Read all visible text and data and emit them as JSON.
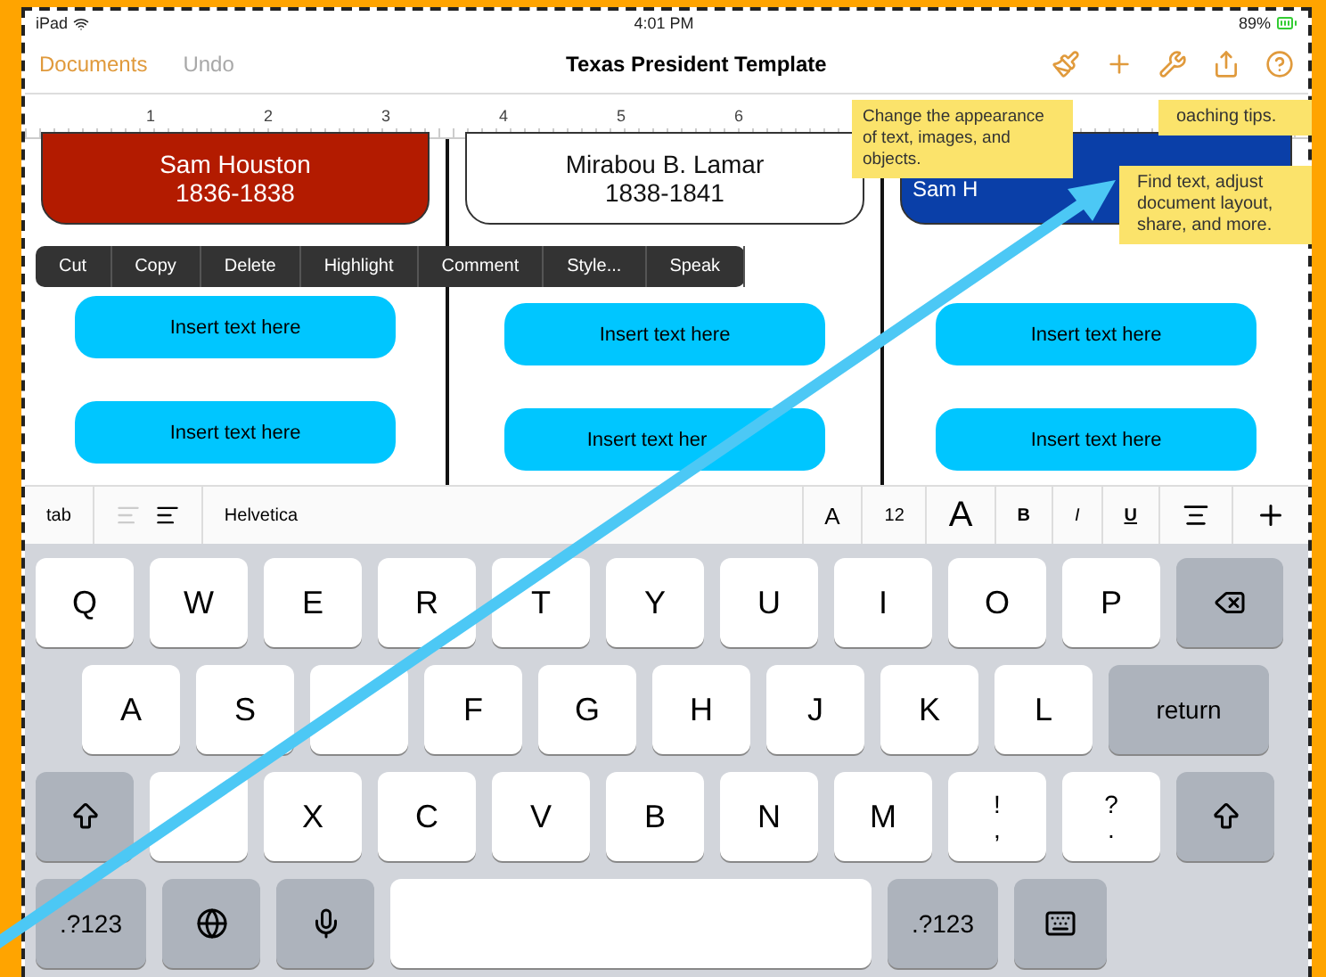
{
  "status_bar": {
    "device": "iPad",
    "time": "4:01 PM",
    "battery": "89%"
  },
  "nav": {
    "left": [
      {
        "label": "Documents",
        "disabled": false
      },
      {
        "label": "Undo",
        "disabled": true
      }
    ],
    "title": "Texas President Template"
  },
  "ruler": {
    "marks": [
      "1",
      "2",
      "3",
      "4",
      "5",
      "6"
    ]
  },
  "tooltips": [
    {
      "text": "Change the appearance of text, images, and objects."
    },
    {
      "text": "oaching tips."
    },
    {
      "text": "Find text, adjust document layout, share, and more."
    }
  ],
  "cards": [
    {
      "name": "Sam Houston",
      "years": "1836-1838",
      "color": "#b31b00"
    },
    {
      "name": "Mirabou B. Lamar",
      "years": "1838-1841",
      "color": "#ffffff"
    },
    {
      "name": "Sam H",
      "color": "#0a3fa8"
    }
  ],
  "edit_menu": [
    "Cut",
    "Copy",
    "Delete",
    "Highlight",
    "Comment",
    "Style...",
    "Speak"
  ],
  "placeholders": [
    [
      "Insert text here",
      "Insert text here"
    ],
    [
      "Insert text here",
      "Insert text her"
    ],
    [
      "Insert text here",
      "Insert text here"
    ]
  ],
  "format_bar": {
    "tab": "tab",
    "font": "Helvetica",
    "small_a": "A",
    "size": "12",
    "large_a": "A",
    "bold": "B",
    "italic": "I",
    "underline": "U"
  },
  "keyboard": [
    [
      {
        "kind": "char",
        "label": "Q"
      },
      {
        "kind": "char",
        "label": "W"
      },
      {
        "kind": "char",
        "label": "E"
      },
      {
        "kind": "char",
        "label": "R"
      },
      {
        "kind": "char",
        "label": "T"
      },
      {
        "kind": "char",
        "label": "Y"
      },
      {
        "kind": "char",
        "label": "U"
      },
      {
        "kind": "char",
        "label": "I"
      },
      {
        "kind": "char",
        "label": "O"
      },
      {
        "kind": "char",
        "label": "P"
      },
      {
        "kind": "delete"
      }
    ],
    [
      {
        "kind": "char",
        "label": "A"
      },
      {
        "kind": "char",
        "label": "S"
      },
      {
        "kind": "char"
      },
      {
        "kind": "char",
        "label": "F"
      },
      {
        "kind": "char",
        "label": "G"
      },
      {
        "kind": "char",
        "label": "H"
      },
      {
        "kind": "char",
        "label": "J"
      },
      {
        "kind": "char",
        "label": "K"
      },
      {
        "kind": "char",
        "label": "L"
      },
      {
        "kind": "wide",
        "label": "return"
      }
    ],
    [
      {
        "kind": "shift"
      },
      {
        "kind": "char"
      },
      {
        "kind": "char",
        "label": "X"
      },
      {
        "kind": "char",
        "label": "C"
      },
      {
        "kind": "char",
        "label": "V"
      },
      {
        "kind": "char",
        "label": "B"
      },
      {
        "kind": "char",
        "label": "N"
      },
      {
        "kind": "char",
        "label": "M"
      },
      {
        "kind": "char",
        "label": "!\n,"
      },
      {
        "kind": "char",
        "label": "?\n."
      },
      {
        "kind": "shift"
      }
    ],
    [
      {
        "kind": "wide",
        "label": ".?123"
      },
      {
        "kind": "globe"
      },
      {
        "kind": "mic"
      },
      {
        "kind": "space"
      },
      {
        "kind": "wide",
        "label": ".?123"
      },
      {
        "kind": "hide"
      }
    ]
  ]
}
